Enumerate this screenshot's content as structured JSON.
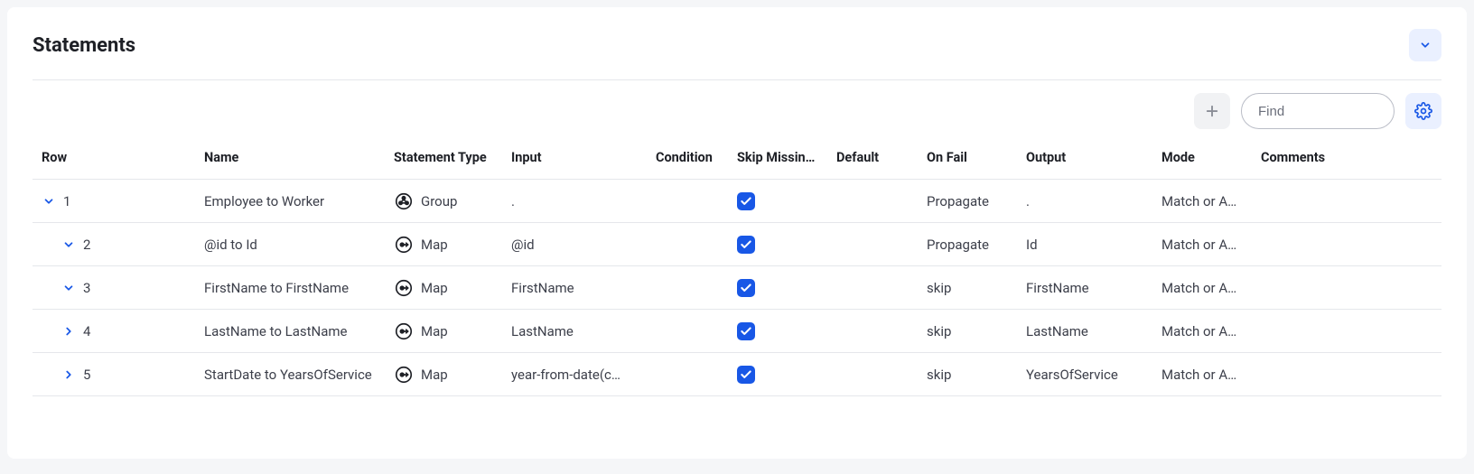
{
  "panel": {
    "title": "Statements"
  },
  "toolbar": {
    "find_placeholder": "Find"
  },
  "columns": {
    "row": "Row",
    "name": "Name",
    "statement_type": "Statement Type",
    "input": "Input",
    "condition": "Condition",
    "skip_missing": "Skip Missin…",
    "default": "Default",
    "on_fail": "On Fail",
    "output": "Output",
    "mode": "Mode",
    "comments": "Comments"
  },
  "rows": [
    {
      "indent": 0,
      "expanded": true,
      "row": "1",
      "name": "Employee to Worker",
      "type": "Group",
      "type_icon": "group",
      "input": ".",
      "condition": "",
      "skip_missing": true,
      "default": "",
      "on_fail": "Propagate",
      "output": ".",
      "mode": "Match or A…",
      "comments": ""
    },
    {
      "indent": 1,
      "expanded": true,
      "row": "2",
      "name": "@id to Id",
      "type": "Map",
      "type_icon": "map",
      "input": "@id",
      "condition": "",
      "skip_missing": true,
      "default": "",
      "on_fail": "Propagate",
      "output": "Id",
      "mode": "Match or A…",
      "comments": ""
    },
    {
      "indent": 1,
      "expanded": true,
      "row": "3",
      "name": "FirstName to FirstName",
      "type": "Map",
      "type_icon": "map",
      "input": "FirstName",
      "condition": "",
      "skip_missing": true,
      "default": "",
      "on_fail": "skip",
      "output": "FirstName",
      "mode": "Match or A…",
      "comments": ""
    },
    {
      "indent": 1,
      "expanded": false,
      "row": "4",
      "name": "LastName to LastName",
      "type": "Map",
      "type_icon": "map",
      "input": "LastName",
      "condition": "",
      "skip_missing": true,
      "default": "",
      "on_fail": "skip",
      "output": "LastName",
      "mode": "Match or A…",
      "comments": ""
    },
    {
      "indent": 1,
      "expanded": false,
      "row": "5",
      "name": "StartDate to YearsOfService",
      "type": "Map",
      "type_icon": "map",
      "input": "year-from-date(c…",
      "condition": "",
      "skip_missing": true,
      "default": "",
      "on_fail": "skip",
      "output": "YearsOfService",
      "mode": "Match or A…",
      "comments": ""
    }
  ]
}
